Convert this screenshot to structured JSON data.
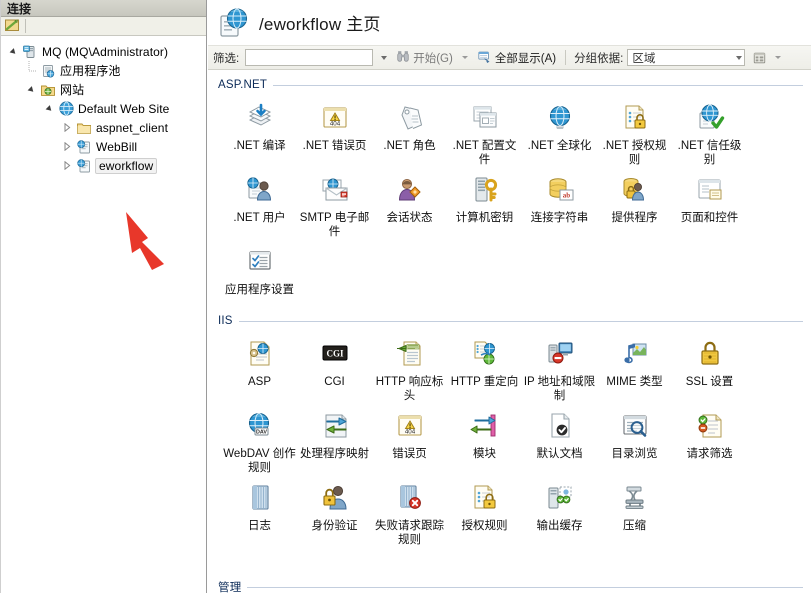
{
  "left": {
    "header_title": "连接",
    "toolbar": {
      "connect_icon": "connect-to-server-icon"
    },
    "tree": [
      {
        "label": "MQ (MQ\\Administrator)",
        "icon": "server-icon",
        "depth": 0,
        "expander": "open",
        "selected": false
      },
      {
        "label": "应用程序池",
        "icon": "app-pools-icon",
        "depth": 1,
        "expander": "none",
        "selected": false
      },
      {
        "label": "网站",
        "icon": "sites-folder-icon",
        "depth": 1,
        "expander": "open",
        "selected": false
      },
      {
        "label": "Default Web Site",
        "icon": "web-site-icon",
        "depth": 2,
        "expander": "open",
        "selected": false
      },
      {
        "label": "aspnet_client",
        "icon": "folder-icon",
        "depth": 3,
        "expander": "closed",
        "selected": false
      },
      {
        "label": "WebBill",
        "icon": "application-icon",
        "depth": 3,
        "expander": "closed",
        "selected": false
      },
      {
        "label": "eworkflow",
        "icon": "application-icon",
        "depth": 3,
        "expander": "closed",
        "selected": true
      }
    ],
    "annotation": {
      "name": "red-arrow-pointer",
      "color": "#e8372a"
    }
  },
  "header": {
    "icon": "web-application-icon",
    "title": "/eworkflow 主页"
  },
  "filter_bar": {
    "filter_label": "筛选:",
    "filter_value": "",
    "go_label": "开始(G)",
    "go_icon": "binoculars-icon",
    "show_all_label": "全部显示(A)",
    "show_all_icon": "show-all-icon",
    "group_by_label": "分组依据:",
    "group_by_value": "区域",
    "view_icon": "view-mode-icon"
  },
  "groups": [
    {
      "title": "ASP.NET",
      "items": [
        {
          "label": ".NET 编译",
          "icon": "net-compilation-icon"
        },
        {
          "label": ".NET 错误页",
          "icon": "net-error-pages-icon"
        },
        {
          "label": ".NET 角色",
          "icon": "net-roles-icon"
        },
        {
          "label": ".NET 配置文件",
          "icon": "net-profile-icon"
        },
        {
          "label": ".NET 全球化",
          "icon": "net-globalization-icon"
        },
        {
          "label": ".NET 授权规则",
          "icon": "net-authorization-rules-icon"
        },
        {
          "label": ".NET 信任级别",
          "icon": "net-trust-levels-icon"
        },
        {
          "label": ".NET 用户",
          "icon": "net-users-icon"
        },
        {
          "label": "SMTP 电子邮件",
          "icon": "smtp-email-icon"
        },
        {
          "label": "会话状态",
          "icon": "session-state-icon"
        },
        {
          "label": "计算机密钥",
          "icon": "machine-key-icon"
        },
        {
          "label": "连接字符串",
          "icon": "connection-strings-icon"
        },
        {
          "label": "提供程序",
          "icon": "providers-icon"
        },
        {
          "label": "页面和控件",
          "icon": "pages-and-controls-icon"
        },
        {
          "label": "应用程序设置",
          "icon": "application-settings-icon"
        }
      ]
    },
    {
      "title": "IIS",
      "items": [
        {
          "label": "ASP",
          "icon": "asp-icon"
        },
        {
          "label": "CGI",
          "icon": "cgi-icon"
        },
        {
          "label": "HTTP 响应标头",
          "icon": "http-response-headers-icon"
        },
        {
          "label": "HTTP 重定向",
          "icon": "http-redirect-icon"
        },
        {
          "label": "IP 地址和域限制",
          "icon": "ip-address-domain-restrictions-icon"
        },
        {
          "label": "MIME 类型",
          "icon": "mime-types-icon"
        },
        {
          "label": "SSL 设置",
          "icon": "ssl-settings-icon"
        },
        {
          "label": "WebDAV 创作规则",
          "icon": "webdav-authoring-rules-icon"
        },
        {
          "label": "处理程序映射",
          "icon": "handler-mappings-icon"
        },
        {
          "label": "错误页",
          "icon": "error-pages-icon"
        },
        {
          "label": "模块",
          "icon": "modules-icon"
        },
        {
          "label": "默认文档",
          "icon": "default-document-icon"
        },
        {
          "label": "目录浏览",
          "icon": "directory-browsing-icon"
        },
        {
          "label": "请求筛选",
          "icon": "request-filtering-icon"
        },
        {
          "label": "日志",
          "icon": "logging-icon"
        },
        {
          "label": "身份验证",
          "icon": "authentication-icon"
        },
        {
          "label": "失败请求跟踪规则",
          "icon": "failed-request-tracing-rules-icon"
        },
        {
          "label": "授权规则",
          "icon": "authorization-rules-icon"
        },
        {
          "label": "输出缓存",
          "icon": "output-caching-icon"
        },
        {
          "label": "压缩",
          "icon": "compression-icon"
        }
      ]
    }
  ],
  "bottom_partial_group": {
    "title": "管理"
  },
  "colors": {
    "header_bar": "#cfcfc6",
    "group_title": "#0b2a57",
    "annotation_red": "#e8372a",
    "selection_border": "#cfcfcf"
  }
}
